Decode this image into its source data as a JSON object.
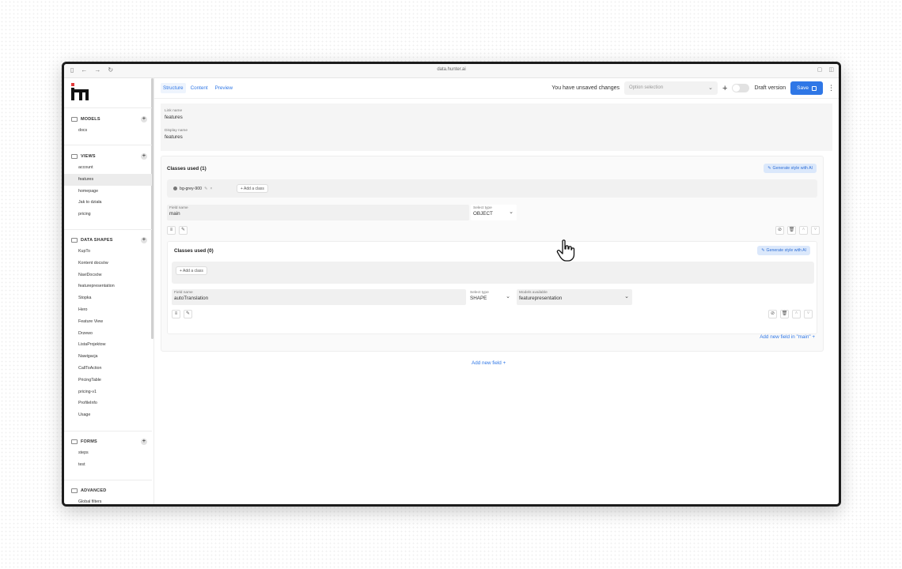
{
  "browser": {
    "url": "data.hunter.ai"
  },
  "sidebar": {
    "models": {
      "title": "MODELS",
      "items": [
        "docs"
      ]
    },
    "views": {
      "title": "VIEWS",
      "items": [
        "account",
        "features",
        "homepage",
        "Jak to działa",
        "pricing"
      ],
      "active": "features"
    },
    "data_shapes": {
      "title": "DATA SHAPES",
      "items": [
        "KupTo",
        "Kontent docsów",
        "NaviDocsów",
        "featurepresentation",
        "Stopka",
        "Hero",
        "Feature View",
        "Drzewo",
        "ListaProjektow",
        "Nawigacja",
        "CallToAction",
        "PricingTable",
        "pricing-v1",
        "ProfileInfo",
        "Usage"
      ]
    },
    "forms": {
      "title": "FORMS",
      "items": [
        "steps",
        "test"
      ]
    },
    "advanced": {
      "title": "ADVANCED",
      "items": [
        "Global filters"
      ]
    }
  },
  "topbar": {
    "tabs": [
      "Structure",
      "Content",
      "Preview"
    ],
    "unsaved": "You have unsaved changes",
    "option_placeholder": "Option selection",
    "draft_label": "Draft version",
    "save_label": "Save"
  },
  "form": {
    "link_name_label": "Link name",
    "link_name_value": "features",
    "display_name_label": "Display name",
    "display_name_value": "features"
  },
  "outer": {
    "classes_title": "Classes used (1)",
    "generate_label": "Generate style with AI",
    "chip_label": "bg-grey-900",
    "add_class_label": "+ Add a class",
    "field_name_label": "Field name",
    "field_name_value": "main",
    "select_type_label": "Select type",
    "select_type_value": "OBJECT"
  },
  "inner": {
    "classes_title": "Classes used (0)",
    "generate_label": "Generate style with AI",
    "add_class_label": "+ Add a class",
    "field_name_label": "Field name",
    "field_name_value": "autoTranslation",
    "select_type_label": "Select type",
    "select_type_value": "SHAPE",
    "models_label": "Models available",
    "models_value": "featurepresentation"
  },
  "add_field_main": "Add new field in \"main\"",
  "add_field": "Add new field",
  "colors": {
    "accent": "#2f77e6",
    "accent_soft": "#dbe8fb"
  }
}
